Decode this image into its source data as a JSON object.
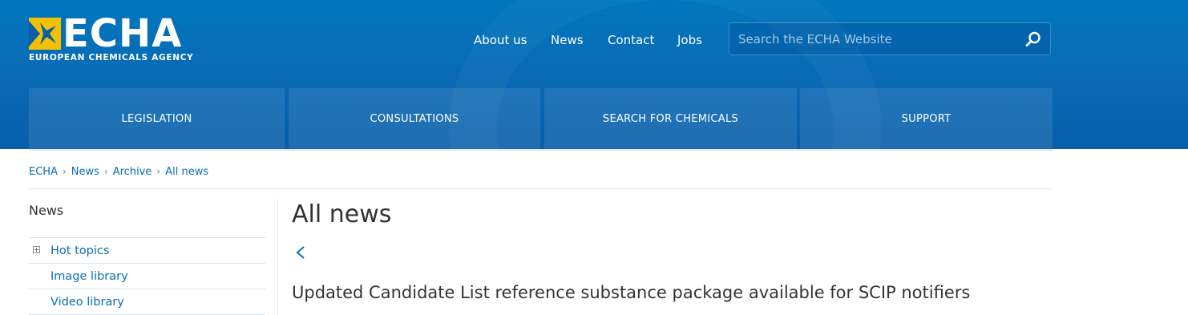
{
  "header": {
    "logo": {
      "wordmark": "ECHA",
      "subtitle": "EUROPEAN CHEMICALS AGENCY",
      "icon": "echa-star-logo"
    },
    "top_nav": [
      "About us",
      "News",
      "Contact",
      "Jobs"
    ],
    "search": {
      "placeholder": "Search the ECHA Website",
      "value": "",
      "icon": "search-icon"
    },
    "main_nav": [
      "LEGISLATION",
      "CONSULTATIONS",
      "SEARCH FOR CHEMICALS",
      "SUPPORT"
    ]
  },
  "breadcrumb": [
    "ECHA",
    "News",
    "Archive",
    "All news"
  ],
  "sidebar": {
    "title": "News",
    "items": [
      {
        "label": "Hot topics",
        "expandable": true
      },
      {
        "label": "Image library",
        "expandable": false
      },
      {
        "label": "Video library",
        "expandable": false
      }
    ]
  },
  "main": {
    "title": "All news",
    "back_icon": "chevron-left-icon",
    "headline": "Updated Candidate List reference substance package available for SCIP notifiers"
  },
  "colors": {
    "header_blue": "#0a6ab4",
    "link_blue": "#0a6fb5",
    "logo_yellow": "#f2c200"
  }
}
